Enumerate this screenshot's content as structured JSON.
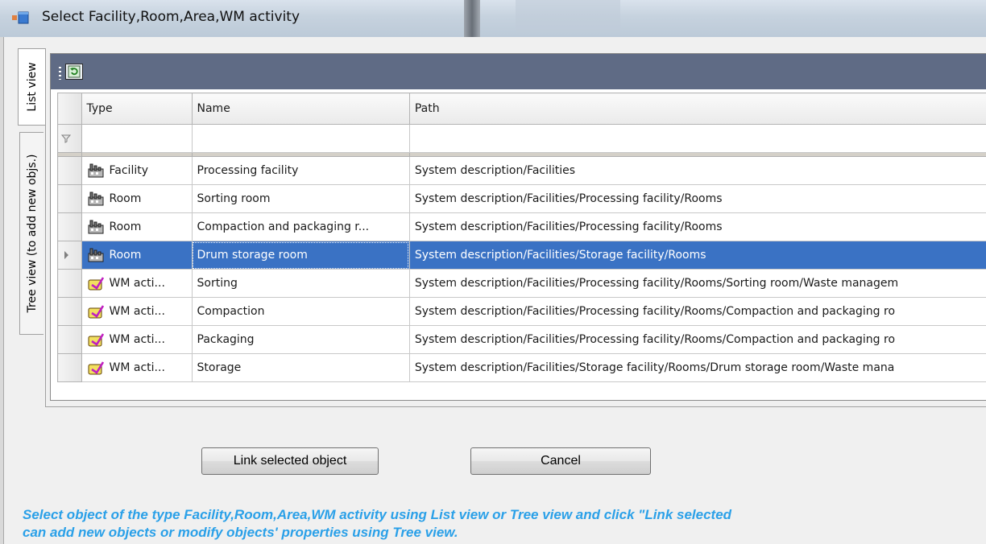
{
  "window": {
    "title": "Select Facility,Room,Area,WM activity",
    "icon": "app-window-icon"
  },
  "tabs": [
    {
      "label": "List view",
      "active": true
    },
    {
      "label": "Tree view (to add new objs.)",
      "active": false
    }
  ],
  "toolbar": {
    "refresh_icon": "refresh-icon"
  },
  "grid": {
    "columns": [
      "Type",
      "Name",
      "Path"
    ],
    "rows": [
      {
        "type": "Facility",
        "icon": "facility-icon",
        "name": "Processing facility",
        "path": "System description/Facilities",
        "selected": false
      },
      {
        "type": "Room",
        "icon": "facility-icon",
        "name": "Sorting room",
        "path": "System description/Facilities/Processing facility/Rooms",
        "selected": false
      },
      {
        "type": "Room",
        "icon": "facility-icon",
        "name": "Compaction and packaging r...",
        "path": "System description/Facilities/Processing facility/Rooms",
        "selected": false
      },
      {
        "type": "Room",
        "icon": "facility-icon",
        "name": "Drum storage room",
        "path": "System description/Facilities/Storage facility/Rooms",
        "selected": true
      },
      {
        "type": "WM acti...",
        "icon": "wm-activity-icon",
        "name": "Sorting",
        "path": "System description/Facilities/Processing facility/Rooms/Sorting room/Waste managem",
        "selected": false
      },
      {
        "type": "WM acti...",
        "icon": "wm-activity-icon",
        "name": "Compaction",
        "path": "System description/Facilities/Processing facility/Rooms/Compaction and packaging ro",
        "selected": false
      },
      {
        "type": "WM acti...",
        "icon": "wm-activity-icon",
        "name": "Packaging",
        "path": "System description/Facilities/Processing facility/Rooms/Compaction and packaging ro",
        "selected": false
      },
      {
        "type": "WM acti...",
        "icon": "wm-activity-icon",
        "name": "Storage",
        "path": "System description/Facilities/Storage facility/Rooms/Drum storage room/Waste mana",
        "selected": false
      }
    ]
  },
  "buttons": {
    "link": "Link selected object",
    "cancel": "Cancel"
  },
  "hint": {
    "line1": "Select object of the type Facility,Room,Area,WM activity using List view or Tree view and click \"Link selected",
    "line2": "can add new objects or modify objects' properties using Tree view."
  },
  "colors": {
    "selection": "#3a72c4",
    "toolbar": "#5f6b85",
    "hint_text": "#2aa0e8"
  }
}
